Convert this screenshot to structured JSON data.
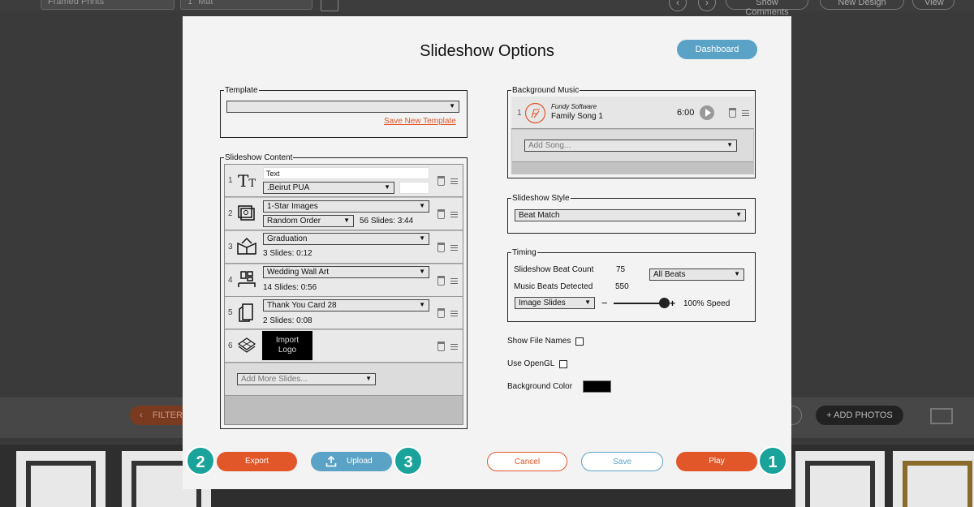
{
  "background": {
    "select_left": "Framed Prints",
    "select_right": "1\" Mat",
    "show_comments": "Show Comments",
    "new_design": "New Design",
    "view": "View",
    "filter": "FILTER",
    "add_photos": "+ ADD PHOTOS"
  },
  "dialog": {
    "title": "Slideshow Options",
    "dashboard_label": "Dashboard"
  },
  "template": {
    "legend": "Template",
    "selected": "",
    "save_link": "Save New Template"
  },
  "content": {
    "legend": "Slideshow Content",
    "rows": [
      {
        "num": "1",
        "text_value": "Text",
        "font_select": ".Beirut PUA"
      },
      {
        "num": "2",
        "select": "1-Star Images",
        "order_select": "Random Order",
        "info": "56 Slides: 3:44"
      },
      {
        "num": "3",
        "select": "Graduation",
        "info": "3 Slides: 0:12"
      },
      {
        "num": "4",
        "select": "Wedding Wall Art",
        "info": "14 Slides: 0:56"
      },
      {
        "num": "5",
        "select": "Thank You Card 28",
        "info": "2 Slides: 0:08"
      },
      {
        "num": "6",
        "logo_button": "Import Logo"
      }
    ],
    "add_more_placeholder": "Add More Slides..."
  },
  "music": {
    "legend": "Background Music",
    "tracks": [
      {
        "num": "1",
        "artist": "Fundy Software",
        "title": "Family Song 1",
        "duration": "6:00"
      }
    ],
    "add_song_placeholder": "Add Song..."
  },
  "style": {
    "legend": "Slideshow Style",
    "selected": "Beat Match"
  },
  "timing": {
    "legend": "Timing",
    "beat_count_label": "Slideshow Beat Count",
    "beat_count_value": "75",
    "beats_select": "All Beats",
    "detected_label": "Music Beats Detected",
    "detected_value": "550",
    "mode_select": "Image Slides",
    "minus": "−",
    "plus": "+",
    "speed_label": "100% Speed",
    "speed_fraction": 0.9
  },
  "options": {
    "show_file_names": "Show File Names",
    "use_opengl": "Use OpenGL",
    "bg_color_label": "Background Color",
    "bg_color": "#000000"
  },
  "footer": {
    "export": "Export",
    "upload": "Upload",
    "cancel": "Cancel",
    "save": "Save",
    "play": "Play",
    "badge_play": "1",
    "badge_export": "2",
    "badge_upload": "3"
  },
  "colors": {
    "accent_orange": "#e1572a",
    "accent_blue": "#5ba3c6",
    "badge_teal": "#1aa39a"
  }
}
